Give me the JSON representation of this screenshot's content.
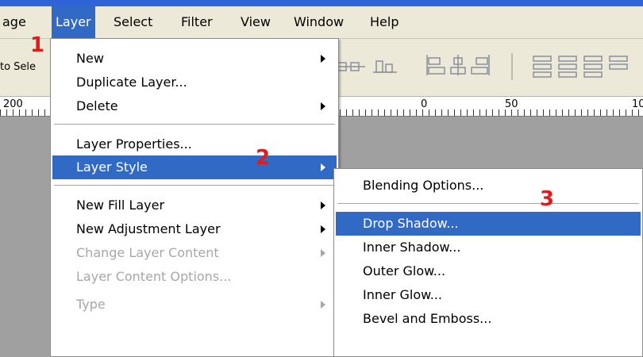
{
  "menubar": {
    "items": [
      "age",
      "Layer",
      "Select",
      "Filter",
      "View",
      "Window",
      "Help"
    ]
  },
  "options_bar": {
    "auto_select": "to Sele"
  },
  "ruler": {
    "labels": [
      "200",
      "0",
      "50",
      "10"
    ]
  },
  "layer_menu": {
    "items": [
      {
        "label": "New",
        "submenu": true
      },
      {
        "label": "Duplicate Layer..."
      },
      {
        "label": "Delete",
        "submenu": true
      },
      {
        "label": "Layer Properties..."
      },
      {
        "label": "Layer Style",
        "submenu": true,
        "highlighted": true
      },
      {
        "label": "New Fill Layer",
        "submenu": true
      },
      {
        "label": "New Adjustment Layer",
        "submenu": true
      },
      {
        "label": "Change Layer Content",
        "submenu": true,
        "disabled": true
      },
      {
        "label": "Layer Content Options...",
        "disabled": true
      },
      {
        "label": "Type",
        "submenu": true,
        "disabled": true
      }
    ]
  },
  "layer_style_menu": {
    "items": [
      {
        "label": "Blending Options..."
      },
      {
        "label": "Drop Shadow...",
        "highlighted": true
      },
      {
        "label": "Inner Shadow..."
      },
      {
        "label": "Outer Glow..."
      },
      {
        "label": "Inner Glow..."
      },
      {
        "label": "Bevel and Emboss..."
      }
    ]
  },
  "step_markers": [
    "1",
    "2",
    "3"
  ],
  "colors": {
    "menubar_bg": "#ece9d8",
    "highlight": "#316ac5",
    "marker": "#e31b1b",
    "disabled_text": "#a7a7a7"
  }
}
